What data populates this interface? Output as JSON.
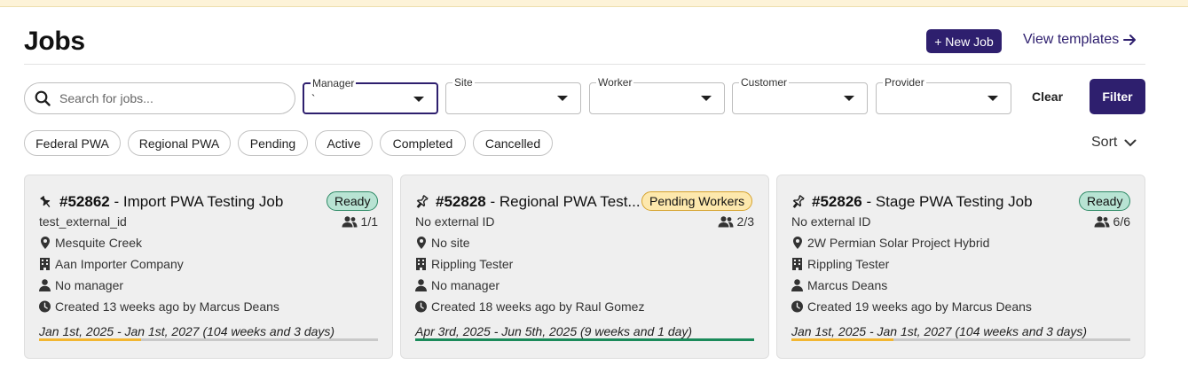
{
  "page": {
    "title": "Jobs"
  },
  "header": {
    "new_job_label": "+ New Job",
    "view_templates_label": "View templates"
  },
  "search": {
    "placeholder": "Search for jobs...",
    "value": ""
  },
  "filters": {
    "manager": {
      "label": "Manager",
      "value": "`"
    },
    "site": {
      "label": "Site",
      "value": ""
    },
    "worker": {
      "label": "Worker",
      "value": ""
    },
    "customer": {
      "label": "Customer",
      "value": ""
    },
    "provider": {
      "label": "Provider",
      "value": ""
    },
    "clear_label": "Clear",
    "filter_label": "Filter"
  },
  "chips": [
    "Federal PWA",
    "Regional PWA",
    "Pending",
    "Active",
    "Completed",
    "Cancelled"
  ],
  "sort_label": "Sort",
  "colors": {
    "brand": "#2e1f6e",
    "ready_bg": "#b8e3d3",
    "pending_bg": "#fde8ad",
    "progress_yellow": "#f2b632",
    "progress_green": "#1a8a5a"
  },
  "jobs": [
    {
      "number": "#52862",
      "name": " - Import PWA Testing Job",
      "status": "Ready",
      "pin_icon": "pin-filled-icon",
      "external_id": "test_external_id",
      "workers": "1/1",
      "site": "Mesquite Creek",
      "company": "Aan Importer Company",
      "manager": "No manager",
      "created": "Created 13 weeks ago by Marcus Deans",
      "dates": "Jan 1st, 2025 - Jan 1st, 2027 (104 weeks and 3 days)",
      "progress": 0.3
    },
    {
      "number": "#52828",
      "name": " - Regional PWA Test...",
      "status": "Pending Workers",
      "pin_icon": "pin-outline-icon",
      "external_id": "No external ID",
      "workers": "2/3",
      "site": "No site",
      "company": "Rippling Tester",
      "manager": "No manager",
      "created": "Created 18 weeks ago by Raul Gomez",
      "dates": "Apr 3rd, 2025 - Jun 5th, 2025 (9 weeks and 1 day)",
      "progress": 1.0
    },
    {
      "number": "#52826",
      "name": " - Stage PWA Testing Job",
      "status": "Ready",
      "pin_icon": "pin-outline-icon",
      "external_id": "No external ID",
      "workers": "6/6",
      "site": "2W Permian Solar Project Hybrid",
      "company": "Rippling Tester",
      "manager": "Marcus Deans",
      "created": "Created 19 weeks ago by Marcus Deans",
      "dates": "Jan 1st, 2025 - Jan 1st, 2027 (104 weeks and 3 days)",
      "progress": 0.3
    }
  ]
}
